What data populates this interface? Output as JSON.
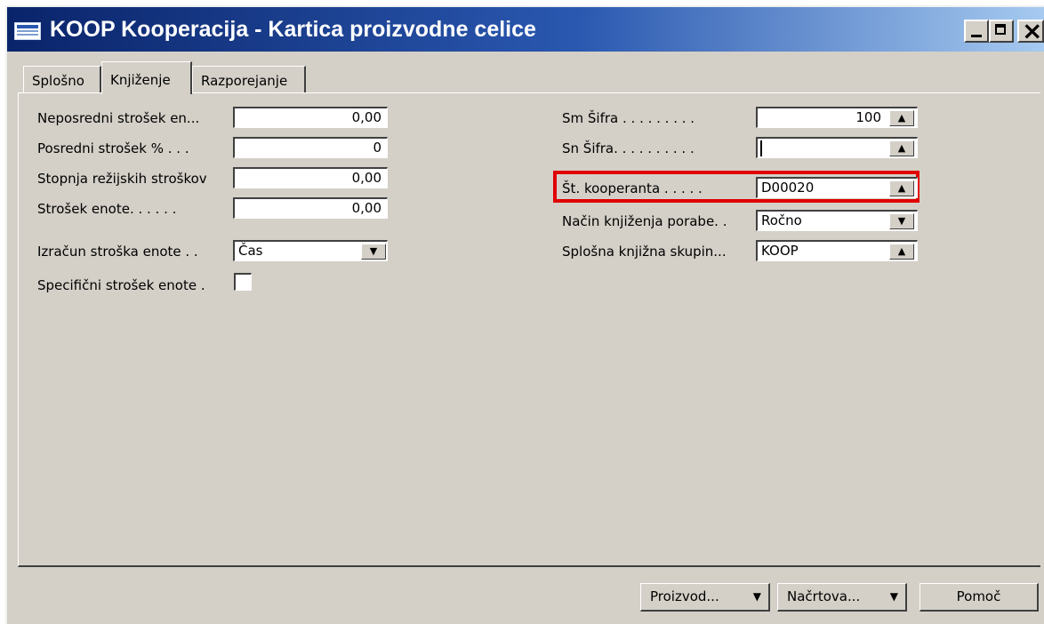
{
  "window": {
    "title": "KOOP Kooperacija - Kartica proizvodne celice",
    "title_icon": "form-icon",
    "controls": {
      "minimize": "minimize-icon",
      "maximize": "maximize-icon",
      "close": "close-icon"
    }
  },
  "tabs": [
    {
      "label": "Splošno",
      "active": false
    },
    {
      "label": "Knjiženje",
      "active": true
    },
    {
      "label": "Razporejanje",
      "active": false
    }
  ],
  "left_fields": [
    {
      "label": "Neposredni strošek en...",
      "value": "0,00"
    },
    {
      "label": "Posredni strošek % . . .",
      "value": "0"
    },
    {
      "label": "Stopnja režijskih stroškov",
      "value": "0,00"
    },
    {
      "label": "Strošek enote. . . . . .",
      "value": "0,00"
    },
    {
      "label": "Izračun stroška enote . .",
      "value": "Čas",
      "type": "dropdown"
    },
    {
      "label": "Specifični strošek enote .",
      "value": false,
      "type": "checkbox"
    }
  ],
  "right_fields": [
    {
      "label": "Sm Šifra . . . . . . . . .",
      "value": "100",
      "type": "lookup"
    },
    {
      "label": "Sn Šifra. . . . . . . . . .",
      "value": "",
      "type": "lookup"
    },
    {
      "label": "Št. kooperanta . . . . .",
      "value": "D00020",
      "type": "lookup",
      "highlighted": true
    },
    {
      "label": "Način knjiženja porabe. .",
      "value": "Ročno",
      "type": "dropdown"
    },
    {
      "label": "Splošna knjižna skupin...",
      "value": "KOOP",
      "type": "lookup"
    }
  ],
  "buttons": [
    {
      "label": "Proizvod...",
      "has_menu": true
    },
    {
      "label": "Načrtova...",
      "has_menu": true
    },
    {
      "label": "Pomoč",
      "has_menu": false
    }
  ],
  "highlight_color": "#e00000",
  "title_bar_color": "#0a246a"
}
